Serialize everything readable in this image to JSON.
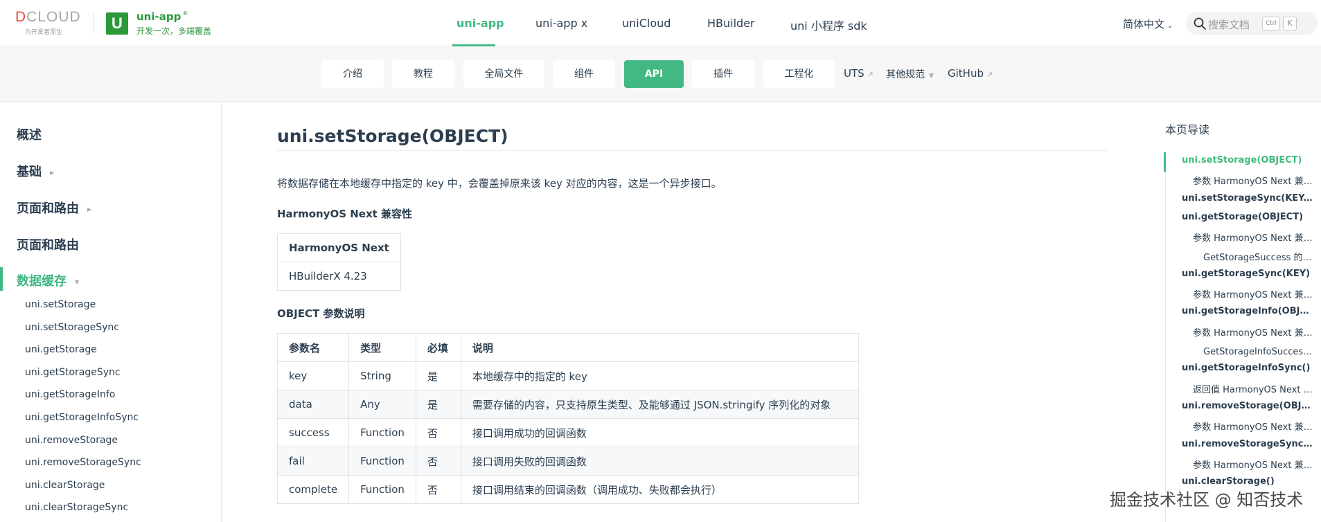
{
  "brand": {
    "dcloud_word": "CLOUD",
    "dcloud_d": "D",
    "dcloud_tagline": "为开发者而生",
    "app_mark": "U",
    "app_name": "uni-app",
    "app_reg": "®",
    "app_slogan": "开发一次，多端覆盖"
  },
  "top_nav": [
    {
      "label": "uni-app",
      "active": true
    },
    {
      "label": "uni-app x"
    },
    {
      "label": "uniCloud"
    },
    {
      "label": "HBuilder"
    },
    {
      "label": "uni 小程序 sdk"
    }
  ],
  "header_right": {
    "language": "简体中文",
    "search_placeholder": "搜索文档",
    "shortcut_keys": [
      "Ctrl",
      "K"
    ]
  },
  "sub_nav": [
    {
      "label": "介绍"
    },
    {
      "label": "教程"
    },
    {
      "label": "全局文件"
    },
    {
      "label": "组件"
    },
    {
      "label": "API",
      "active": true
    },
    {
      "label": "插件"
    },
    {
      "label": "工程化"
    },
    {
      "label": "UTS",
      "external": true
    },
    {
      "label": "其他规范",
      "dropdown": true
    },
    {
      "label": "GitHub",
      "external": true
    }
  ],
  "sidebar": {
    "groups": [
      "概述",
      "基础",
      "页面和路由",
      "数据缓存"
    ],
    "active_group": "数据缓存",
    "items": [
      "uni.setStorage",
      "uni.setStorageSync",
      "uni.getStorage",
      "uni.getStorageSync",
      "uni.getStorageInfo",
      "uni.getStorageInfoSync",
      "uni.removeStorage",
      "uni.removeStorageSync",
      "uni.clearStorage",
      "uni.clearStorageSync"
    ]
  },
  "main": {
    "title": "uni.setStorage(OBJECT)",
    "description": "将数据存储在本地缓存中指定的 key 中，会覆盖掉原来该 key 对应的内容，这是一个异步接口。",
    "compat_heading": "HarmonyOS Next 兼容性",
    "compat_table": {
      "header": "HarmonyOS Next",
      "value": "HBuilderX 4.23"
    },
    "params_heading": "OBJECT 参数说明",
    "params_table": {
      "headers": [
        "参数名",
        "类型",
        "必填",
        "说明"
      ],
      "rows": [
        [
          "key",
          "String",
          "是",
          "本地缓存中的指定的 key"
        ],
        [
          "data",
          "Any",
          "是",
          "需要存储的内容，只支持原生类型、及能够通过 JSON.stringify 序列化的对象"
        ],
        [
          "success",
          "Function",
          "否",
          "接口调用成功的回调函数"
        ],
        [
          "fail",
          "Function",
          "否",
          "接口调用失败的回调函数"
        ],
        [
          "complete",
          "Function",
          "否",
          "接口调用结束的回调函数（调用成功、失败都会执行）"
        ]
      ]
    }
  },
  "toc": {
    "title": "本页导读",
    "items": [
      {
        "label": "uni.setStorage(OBJECT)",
        "level": 1,
        "active": true
      },
      {
        "label": "参数 HarmonyOS Next 兼容性",
        "level": 2
      },
      {
        "label": "uni.setStorageSync(KEY,DATA)",
        "level": 1
      },
      {
        "label": "uni.getStorage(OBJECT)",
        "level": 1
      },
      {
        "label": "参数 HarmonyOS Next 兼容性",
        "level": 2
      },
      {
        "label": "GetStorageSuccess 的属性值",
        "level": 3
      },
      {
        "label": "uni.getStorageSync(KEY)",
        "level": 1
      },
      {
        "label": "参数 HarmonyOS Next 兼容性",
        "level": 2
      },
      {
        "label": "uni.getStorageInfo(OBJECT)",
        "level": 1
      },
      {
        "label": "参数 HarmonyOS Next 兼容性",
        "level": 2
      },
      {
        "label": "GetStorageInfoSuccess 的属性值",
        "level": 3
      },
      {
        "label": "uni.getStorageInfoSync()",
        "level": 1
      },
      {
        "label": "返回值 HarmonyOS Next 兼容性",
        "level": 2
      },
      {
        "label": "uni.removeStorage(OBJECT)",
        "level": 1
      },
      {
        "label": "参数 HarmonyOS Next 兼容性",
        "level": 2
      },
      {
        "label": "uni.removeStorageSync(KEY)",
        "level": 1
      },
      {
        "label": "参数 HarmonyOS Next 兼容性",
        "level": 2
      },
      {
        "label": "uni.clearStorage()",
        "level": 1
      }
    ]
  },
  "watermark": "掘金技术社区 @ 知否技术",
  "colors": {
    "accent": "#42b983",
    "brand_green": "#2b9939",
    "text": "#2c3e50"
  }
}
